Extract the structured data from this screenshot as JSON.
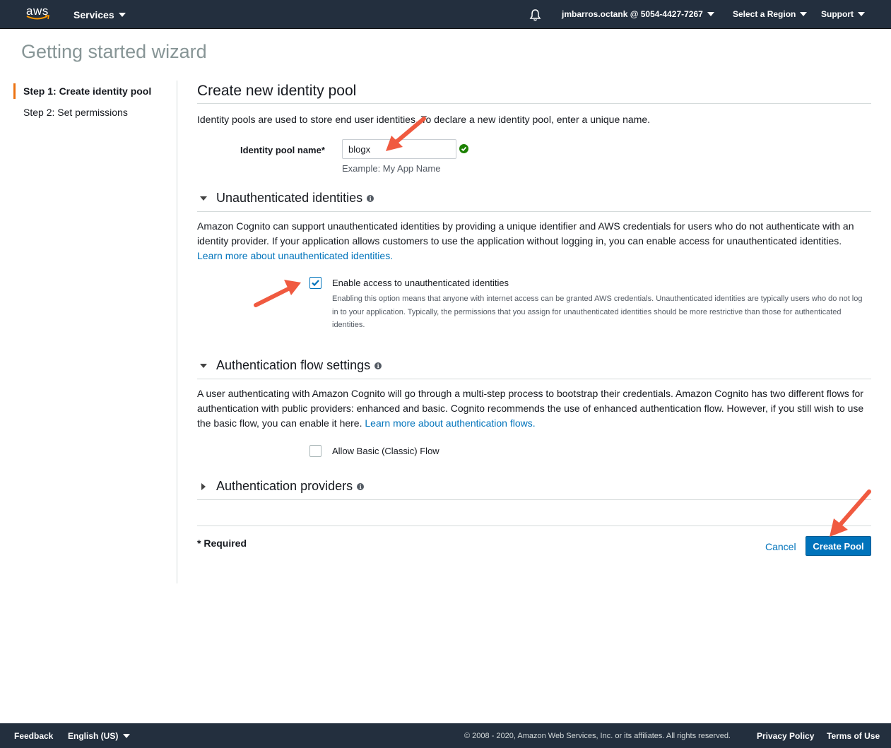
{
  "nav": {
    "logo_text": "aws",
    "services_label": "Services",
    "account_label": "jmbarros.octank @ 5054-4427-7267",
    "region_label": "Select a Region",
    "support_label": "Support"
  },
  "page_title": "Getting started wizard",
  "steps": [
    {
      "label": "Step 1: Create identity pool",
      "active": true
    },
    {
      "label": "Step 2: Set permissions",
      "active": false
    }
  ],
  "main": {
    "heading": "Create new identity pool",
    "intro": "Identity pools are used to store end user identities. To declare a new identity pool, enter a unique name.",
    "pool_name_label": "Identity pool name*",
    "pool_name_value": "blogx",
    "pool_name_hint": "Example: My App Name"
  },
  "unauth": {
    "title": "Unauthenticated identities",
    "body": "Amazon Cognito can support unauthenticated identities by providing a unique identifier and AWS credentials for users who do not authenticate with an identity provider. If your application allows customers to use the application without logging in, you can enable access for unauthenticated identities.",
    "link": "Learn more about unauthenticated identities.",
    "checkbox_label": "Enable access to unauthenticated identities",
    "checkbox_checked": true,
    "checkbox_desc": "Enabling this option means that anyone with internet access can be granted AWS credentials. Unauthenticated identities are typically users who do not log in to your application. Typically, the permissions that you assign for unauthenticated identities should be more restrictive than those for authenticated identities."
  },
  "authflow": {
    "title": "Authentication flow settings",
    "body": "A user authenticating with Amazon Cognito will go through a multi-step process to bootstrap their credentials. Amazon Cognito has two different flows for authentication with public providers: enhanced and basic. Cognito recommends the use of enhanced authentication flow. However, if you still wish to use the basic flow, you can enable it here.",
    "link": "Learn more about authentication flows.",
    "checkbox_label": "Allow Basic (Classic) Flow",
    "checkbox_checked": false
  },
  "providers": {
    "title": "Authentication providers"
  },
  "actions": {
    "required": "* Required",
    "cancel": "Cancel",
    "create": "Create Pool"
  },
  "footer": {
    "feedback": "Feedback",
    "language": "English (US)",
    "copyright": "© 2008 - 2020, Amazon Web Services, Inc. or its affiliates. All rights reserved.",
    "privacy": "Privacy Policy",
    "terms": "Terms of Use"
  },
  "colors": {
    "nav_bg": "#232f3e",
    "accent": "#ec7211",
    "link": "#0073bb",
    "success": "#1d8102",
    "annotation": "#f05a40"
  }
}
